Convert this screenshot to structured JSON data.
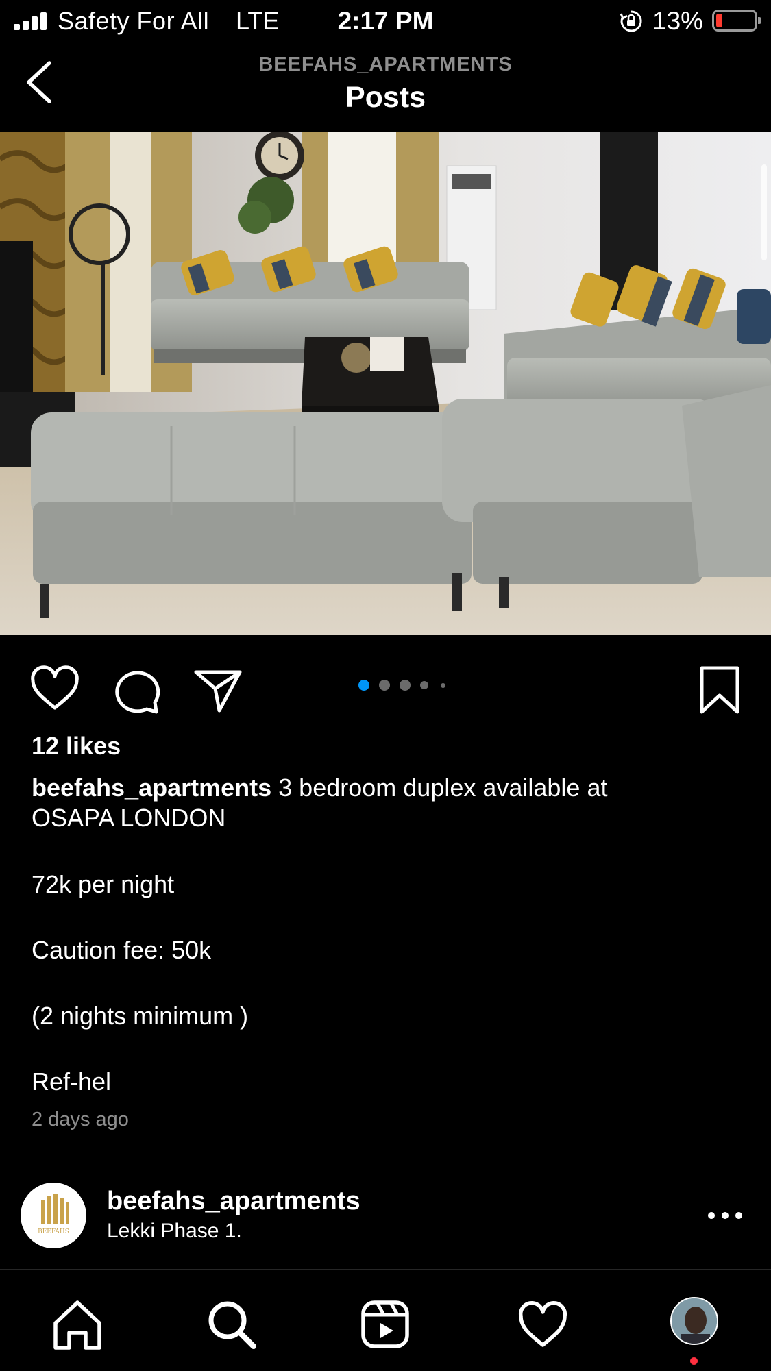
{
  "status_bar": {
    "carrier": "Safety For All",
    "network": "LTE",
    "time": "2:17 PM",
    "battery_percent": "13%",
    "battery_level": 0.13,
    "icons": [
      "signal-icon",
      "rotation-lock-icon",
      "battery-icon"
    ]
  },
  "header": {
    "account": "BEEFAHS_APARTMENTS",
    "title": "Posts",
    "back_icon": "chevron-left-icon"
  },
  "post": {
    "image_alt": "Living room with grey sectional sofa, yellow and grey cushions, coffee table, curtains and wall clock",
    "carousel": {
      "count": 5,
      "active_index": 0
    },
    "actions": [
      "like-icon",
      "comment-icon",
      "share-icon",
      "bookmark-icon"
    ],
    "likes": "12 likes",
    "caption_user": "beefahs_apartments",
    "caption_first": " 3 bedroom duplex available at",
    "caption_second": "OSAPA LONDON",
    "caption_lines": [
      "72k per night",
      "Caution fee: 50k",
      "(2 nights minimum )",
      "Ref-hel"
    ],
    "time_ago": "2 days ago"
  },
  "next_post": {
    "username": "beefahs_apartments",
    "location": "Lekki Phase 1.",
    "logo_text": "BEEFAHS"
  },
  "tab_bar": {
    "tabs": [
      "home-icon",
      "search-icon",
      "reels-icon",
      "activity-icon",
      "profile-avatar"
    ]
  },
  "colors": {
    "background": "#000000",
    "accent": "#0095f6",
    "muted": "#8e8e8e",
    "notification": "#ff3040"
  }
}
